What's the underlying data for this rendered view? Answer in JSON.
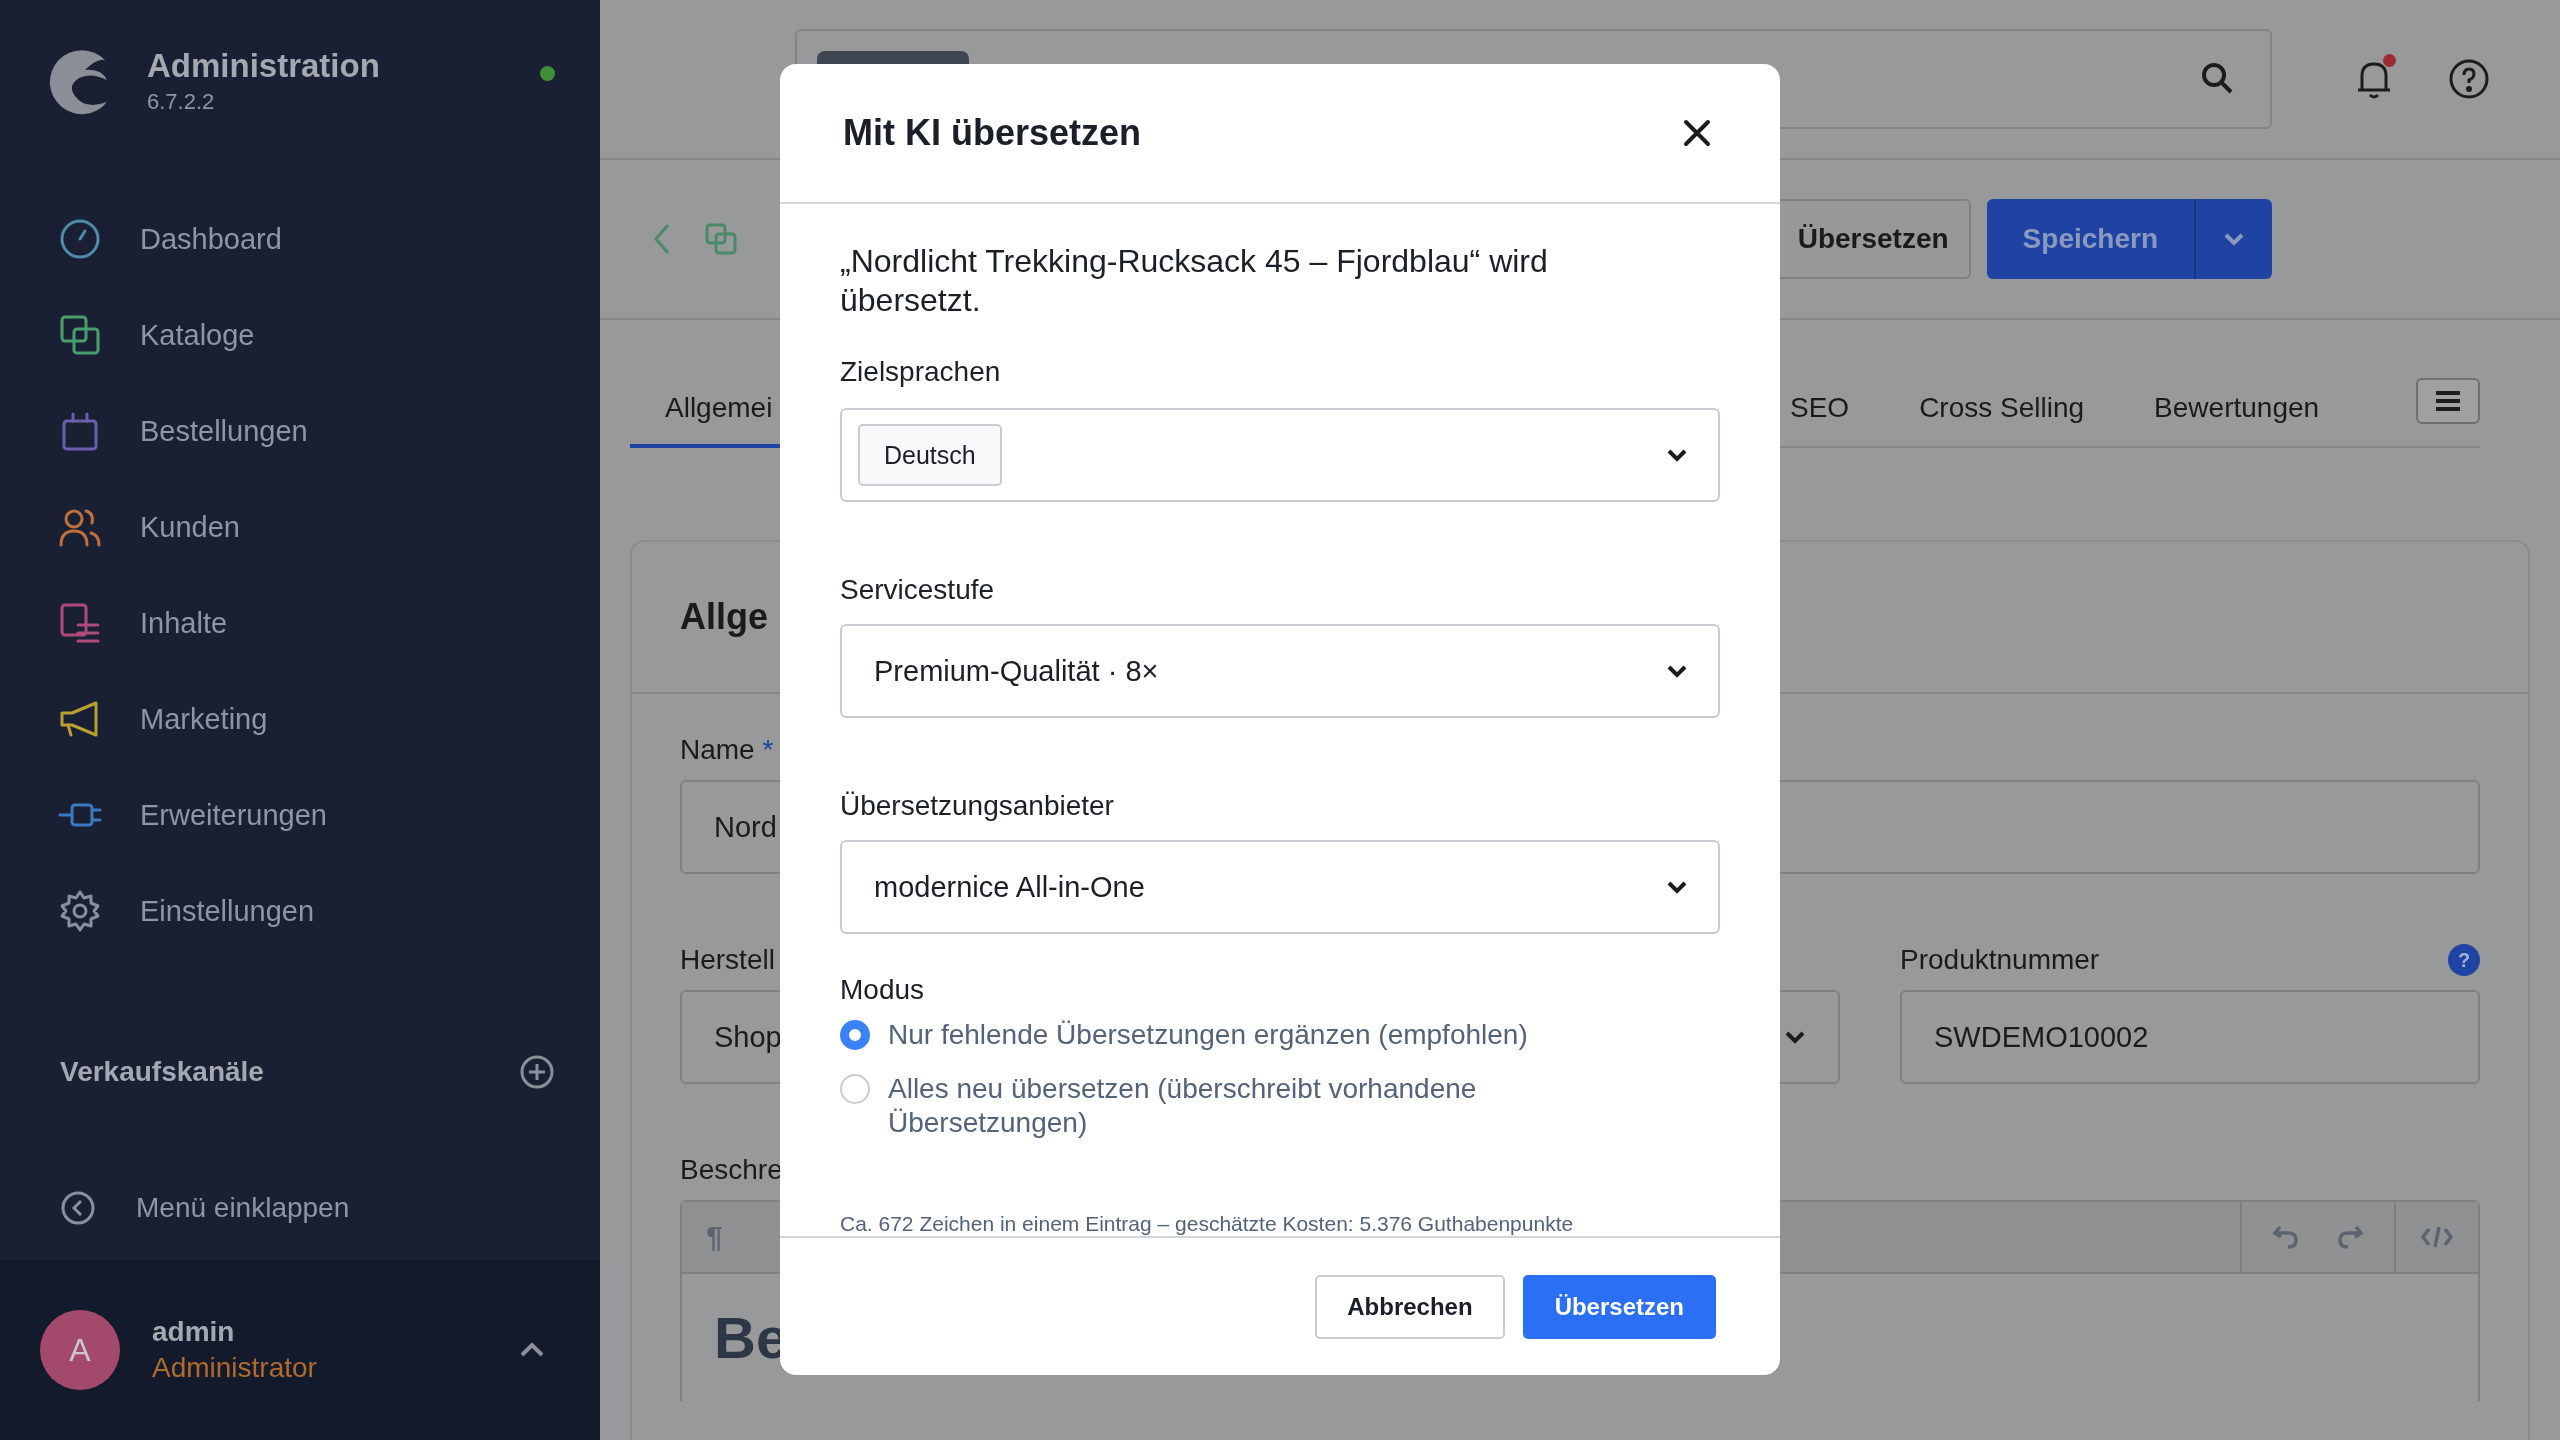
{
  "sidebar": {
    "title": "Administration",
    "version": "6.7.2.2",
    "online": true,
    "nav": [
      {
        "label": "Dashboard",
        "color": "#4f8ca6"
      },
      {
        "label": "Kataloge",
        "color": "#4a9e6e"
      },
      {
        "label": "Bestellungen",
        "color": "#6a5fb0"
      },
      {
        "label": "Kunden",
        "color": "#c0703e"
      },
      {
        "label": "Inhalte",
        "color": "#b04a7a"
      },
      {
        "label": "Marketing",
        "color": "#b9a030"
      },
      {
        "label": "Erweiterungen",
        "color": "#3a7ac0"
      },
      {
        "label": "Einstellungen",
        "color": "#8a8f99"
      }
    ],
    "sales_channels": "Verkaufskanäle",
    "collapse": "Menü einklappen",
    "user": {
      "initial": "A",
      "name": "admin",
      "role": "Administrator"
    }
  },
  "topbar": {
    "notifications_unread": true
  },
  "header": {
    "translate_button": "Übersetzen",
    "save_button": "Speichern"
  },
  "tabs": [
    {
      "label": "Allgemei",
      "selected": true
    },
    {
      "label": "SEO",
      "selected": false
    },
    {
      "label": "Cross Selling",
      "selected": false
    },
    {
      "label": "Bewertungen",
      "selected": false
    }
  ],
  "card": {
    "title": "Allge",
    "name_label": "Name",
    "required_mark": "*",
    "name_value": "Nord",
    "manufacturer_label": "Herstell",
    "manufacturer_value": "Shop",
    "product_number_label": "Produktnummer",
    "help_mark": "?",
    "product_number_value": "SWDEMO10002",
    "description_label": "Beschre",
    "paragraph_mark": "¶",
    "editor_heading": "Be"
  },
  "modal": {
    "title": "Mit KI übersetzen",
    "intro": "„Nordlicht Trekking-Rucksack 45 – Fjordblau“ wird übersetzt.",
    "target_languages": {
      "label": "Zielsprachen",
      "tags": [
        "Deutsch"
      ]
    },
    "service_level": {
      "label": "Servicestufe",
      "value": "Premium-Qualität · 8×"
    },
    "provider": {
      "label": "Übersetzungsanbieter",
      "value": "modernice All-in-One"
    },
    "mode": {
      "label": "Modus",
      "options": [
        {
          "label": "Nur fehlende Übersetzungen ergänzen (empfohlen)",
          "selected": true
        },
        {
          "label": "Alles neu übersetzen (überschreibt vorhandene Übersetzungen)",
          "selected": false
        }
      ]
    },
    "cost_note": "Ca. 672 Zeichen in einem Eintrag – geschätzte Kosten: 5.376 Guthabenpunkte",
    "cancel_button": "Abbrechen",
    "confirm_button": "Übersetzen"
  }
}
